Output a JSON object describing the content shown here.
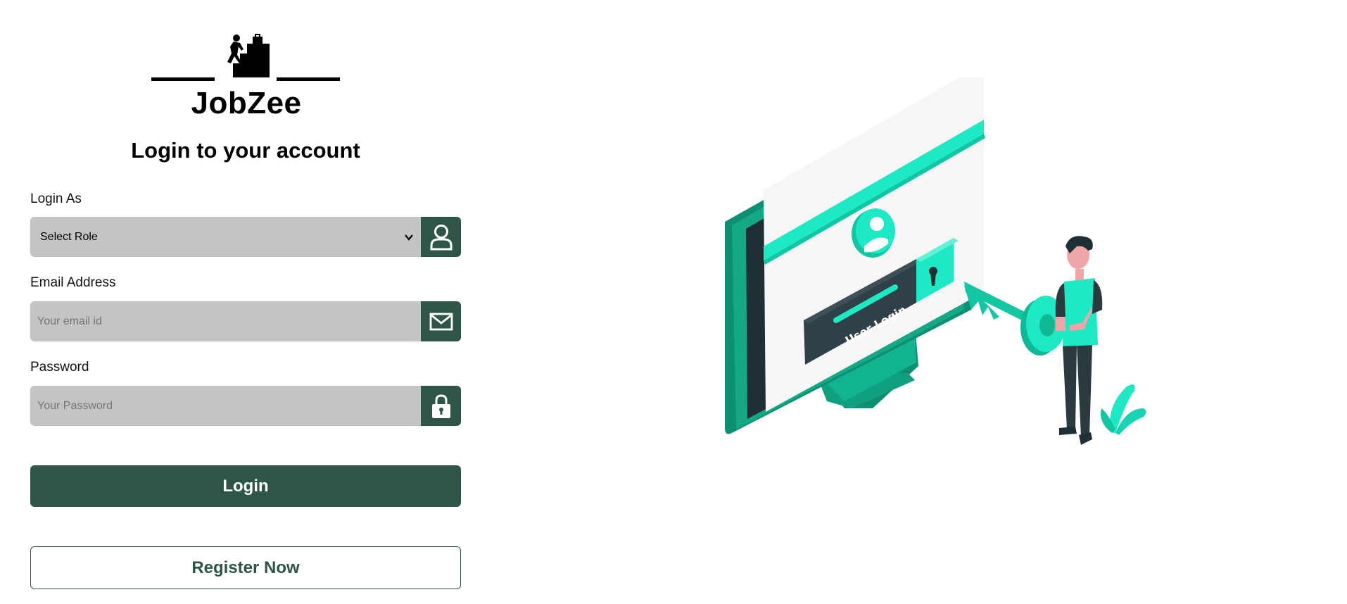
{
  "brand": {
    "name": "JobZee"
  },
  "heading": "Login to your account",
  "form": {
    "role": {
      "label": "Login As",
      "selected": "Select Role",
      "icon": "user-icon"
    },
    "email": {
      "label": "Email Address",
      "placeholder": "Your email id",
      "value": "",
      "icon": "mail-icon"
    },
    "password": {
      "label": "Password",
      "placeholder": "Your Password",
      "value": "",
      "icon": "lock-icon"
    }
  },
  "buttons": {
    "login": "Login",
    "register": "Register Now"
  },
  "illustration": {
    "screen_text": "User Login"
  },
  "colors": {
    "primary": "#2d5649",
    "accent": "#1de9c4",
    "input_bg": "#c4c4c4"
  }
}
